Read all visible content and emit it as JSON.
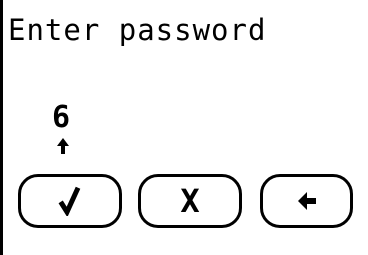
{
  "screen": {
    "prompt": "Enter password"
  },
  "password_entry": {
    "current_digit": "6",
    "cursor_icon": "up-arrow-icon"
  },
  "buttons": {
    "confirm_icon": "check-icon",
    "cancel_label": "X",
    "back_icon": "left-arrow-icon"
  }
}
